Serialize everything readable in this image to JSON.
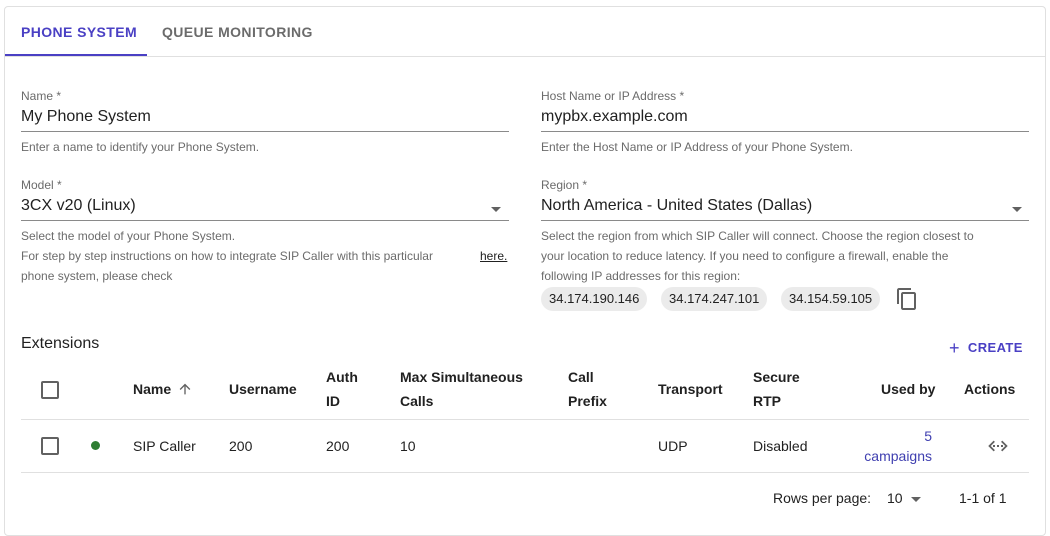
{
  "tabs": [
    {
      "label": "PHONE SYSTEM",
      "active": true
    },
    {
      "label": "QUEUE MONITORING",
      "active": false
    }
  ],
  "form": {
    "name": {
      "label": "Name *",
      "value": "My Phone System",
      "helper": "Enter a name to identify your Phone System."
    },
    "host": {
      "label": "Host Name or IP Address *",
      "value": "mypbx.example.com",
      "helper": "Enter the Host Name or IP Address of your Phone System."
    },
    "model": {
      "label": "Model *",
      "value": "3CX v20 (Linux)",
      "helper1": "Select the model of your Phone System.",
      "helper2_line1": "For step by step instructions on how to integrate SIP Caller with this particular",
      "helper2_line2": "phone system, please check",
      "link": "here."
    },
    "region": {
      "label": "Region *",
      "value": "North America - United States (Dallas)",
      "helper_line1": "Select the region from which SIP Caller will connect. Choose the region closest to",
      "helper_line2": "your location to reduce latency. If you need to configure a firewall, enable the",
      "helper_line3": "following IP addresses for this region:",
      "ips": [
        "34.174.190.146",
        "34.174.247.101",
        "34.154.59.105"
      ]
    }
  },
  "extensions": {
    "title": "Extensions",
    "create_label": "CREATE",
    "columns": {
      "name": "Name",
      "username": "Username",
      "auth_id_1": "Auth",
      "auth_id_2": "ID",
      "max_sim_1": "Max Simultaneous",
      "max_sim_2": "Calls",
      "call_prefix_1": "Call",
      "call_prefix_2": "Prefix",
      "transport": "Transport",
      "secure_rtp_1": "Secure",
      "secure_rtp_2": "RTP",
      "used_by": "Used by",
      "actions": "Actions"
    },
    "rows": [
      {
        "status_color": "#2e7d32",
        "name": "SIP Caller",
        "username": "200",
        "auth_id": "200",
        "max_simultaneous_calls": "10",
        "call_prefix": "",
        "transport": "UDP",
        "secure_rtp": "Disabled",
        "used_by_count": "5",
        "used_by_label": "campaigns",
        "actions_icon": "code-icon"
      }
    ],
    "pagination": {
      "rows_per_page_label": "Rows per page:",
      "rows_per_page": "10",
      "range": "1-1 of 1"
    }
  },
  "colors": {
    "accent": "#4a40c4",
    "status_active": "#2e7d32"
  }
}
